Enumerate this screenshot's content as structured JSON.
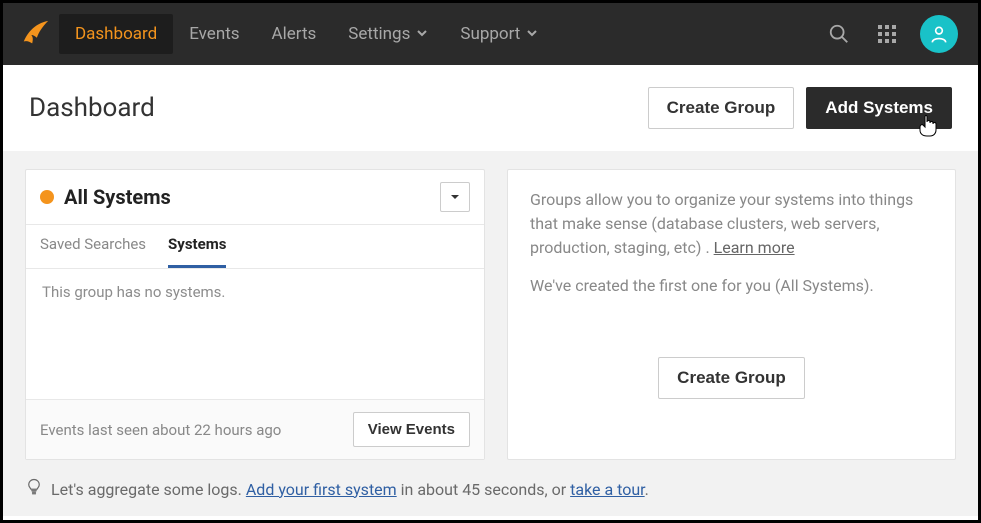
{
  "nav": {
    "items": [
      {
        "label": "Dashboard",
        "active": true
      },
      {
        "label": "Events"
      },
      {
        "label": "Alerts"
      },
      {
        "label": "Settings",
        "chev": true
      },
      {
        "label": "Support",
        "chev": true
      }
    ]
  },
  "header": {
    "title": "Dashboard",
    "create_group": "Create Group",
    "add_systems": "Add Systems"
  },
  "left": {
    "title": "All Systems",
    "tabs": {
      "saved": "Saved Searches",
      "systems": "Systems"
    },
    "empty": "This group has no systems.",
    "footer_text": "Events last seen about 22 hours ago",
    "view_events": "View Events"
  },
  "right": {
    "p1_a": "Groups allow you to organize your systems into things that make sense (database clusters, web servers, production, staging, etc) . ",
    "p1_link": "Learn more",
    "p2": "We've created the first one for you (All Systems).",
    "create_group": "Create Group"
  },
  "tip": {
    "pre": "Let's aggregate some logs. ",
    "link1": "Add your first system",
    "mid": " in about 45 seconds, or ",
    "link2": "take a tour",
    "post": "."
  }
}
